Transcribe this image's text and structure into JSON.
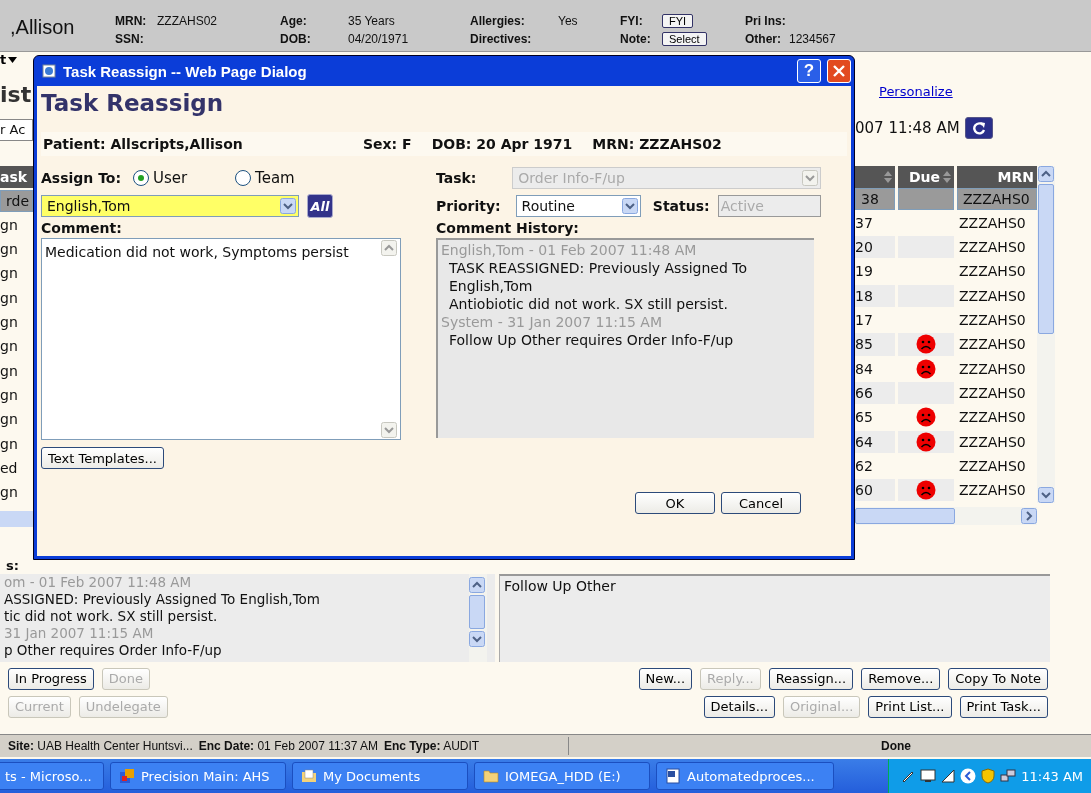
{
  "header": {
    "patient_name": ",Allison",
    "columns": [
      {
        "rows": [
          {
            "label": "MRN:",
            "value": "ZZZAHS02",
            "kind": "text"
          },
          {
            "label": "SSN:"
          }
        ]
      },
      {
        "rows": [
          {
            "label": "Age:",
            "value": "35 Years",
            "kind": "text"
          },
          {
            "label": "DOB:",
            "value": "04/20/1971",
            "kind": "text"
          }
        ]
      },
      {
        "rows": [
          {
            "label": "Allergies:",
            "value": "Yes",
            "kind": "text"
          },
          {
            "label": "Directives:"
          }
        ]
      },
      {
        "rows": [
          {
            "label": "FYI:",
            "value": "FYI",
            "kind": "button"
          },
          {
            "label": "Note:",
            "value": "Select",
            "kind": "button"
          }
        ]
      },
      {
        "rows": [
          {
            "label": "Pri Ins:"
          },
          {
            "label": "Other:",
            "value": "1234567",
            "kind": "text"
          }
        ]
      }
    ]
  },
  "menu": {
    "label": "t"
  },
  "page": {
    "title": "ist",
    "filter": "r Ac",
    "personalize": "Personalize",
    "timestamp": "007 11:48 AM"
  },
  "tasks": {
    "columns": [
      {
        "label": "ask"
      },
      {
        "sortable": true
      },
      {
        "label": "Due",
        "sortable": true
      },
      {
        "label": "MRN"
      }
    ],
    "rows": [
      {
        "column_1": "rde",
        "column_2": "38",
        "overdue": false,
        "mrn": "ZZZAHS0",
        "selected": true
      },
      {
        "column_1": "gn",
        "column_2": "37",
        "overdue": false,
        "mrn": "ZZZAHS0",
        "selected": false
      },
      {
        "column_1": "gn",
        "column_2": "20",
        "overdue": false,
        "mrn": "ZZZAHS0",
        "selected": false
      },
      {
        "column_1": "gn",
        "column_2": "19",
        "overdue": false,
        "mrn": "ZZZAHS0",
        "selected": false
      },
      {
        "column_1": "gn",
        "column_2": "18",
        "overdue": false,
        "mrn": "ZZZAHS0",
        "selected": false
      },
      {
        "column_1": "gn",
        "column_2": "17",
        "overdue": false,
        "mrn": "ZZZAHS0",
        "selected": false
      },
      {
        "column_1": "gn",
        "column_2": "85",
        "overdue": true,
        "mrn": "ZZZAHS0",
        "selected": false
      },
      {
        "column_1": "gn",
        "column_2": "84",
        "overdue": true,
        "mrn": "ZZZAHS0",
        "selected": false
      },
      {
        "column_1": "gn",
        "column_2": "66",
        "overdue": false,
        "mrn": "ZZZAHS0",
        "selected": false
      },
      {
        "column_1": "gn",
        "column_2": "65",
        "overdue": true,
        "mrn": "ZZZAHS0",
        "selected": false
      },
      {
        "column_1": "gn",
        "column_2": "64",
        "overdue": true,
        "mrn": "ZZZAHS0",
        "selected": false
      },
      {
        "column_1": "ed",
        "column_2": "62",
        "overdue": false,
        "mrn": "ZZZAHS0",
        "selected": false
      },
      {
        "column_1": "gn",
        "column_2": "60",
        "overdue": true,
        "mrn": "ZZZAHS0",
        "selected": false
      }
    ]
  },
  "dialog": {
    "title": "Task Reassign -- Web Page Dialog",
    "help": "?",
    "heading": "Task Reassign",
    "patient": [
      {
        "label": "Patient:",
        "value": "Allscripts,Allison"
      },
      {
        "label": "Sex:",
        "value": "F"
      },
      {
        "label": "DOB:",
        "value": "20 Apr 1971"
      },
      {
        "label": "MRN:",
        "value": "ZZZAHS02"
      }
    ],
    "assign_to": {
      "label": "Assign To:",
      "options": [
        {
          "label": "User",
          "selected": true
        },
        {
          "label": "Team",
          "selected": false
        }
      ]
    },
    "assignee": {
      "value": "English,Tom",
      "all_button": "All"
    },
    "task": {
      "label": "Task:",
      "value": "Order Info-F/up",
      "disabled": true
    },
    "priority": {
      "label": "Priority:",
      "value": "Routine"
    },
    "status": {
      "label": "Status:",
      "value": "Active",
      "disabled": true
    },
    "comment": {
      "label": "Comment:",
      "value": "Medication did not work, Symptoms persist"
    },
    "history": {
      "label": "Comment History:",
      "entries": [
        {
          "kind": "header",
          "text": "English,Tom - 01 Feb 2007 11:48 AM"
        },
        {
          "kind": "body",
          "text": "TASK REASSIGNED: Previously Assigned To English,Tom"
        },
        {
          "kind": "body",
          "text": "Antiobiotic did not work. SX still persist."
        },
        {
          "kind": "header",
          "text": "System - 31 Jan 2007 11:15 AM"
        },
        {
          "kind": "body",
          "text": "Follow Up Other requires Order Info-F/up"
        }
      ]
    },
    "templates_button": {
      "label": "Text Templates..."
    },
    "buttons": [
      {
        "label": "OK"
      },
      {
        "label": "Cancel"
      }
    ]
  },
  "details": {
    "label": "s:",
    "history": [
      {
        "kind": "header",
        "text": "om - 01 Feb 2007 11:48 AM"
      },
      {
        "kind": "body",
        "text": "ASSIGNED: Previously Assigned To English,Tom"
      },
      {
        "kind": "body",
        "text": "tic did not work. SX still persist."
      },
      {
        "kind": "header",
        "text": "31 Jan 2007 11:15 AM"
      },
      {
        "kind": "body",
        "text": "p Other requires Order Info-F/up"
      }
    ],
    "description": "Follow Up Other"
  },
  "actions": {
    "row_1_left": [
      {
        "label": "In Progress",
        "disabled": false
      },
      {
        "label": "Done",
        "disabled": true
      }
    ],
    "row_1_right": [
      {
        "label": "New...",
        "disabled": false
      },
      {
        "label": "Reply...",
        "disabled": true
      },
      {
        "label": "Reassign...",
        "disabled": false
      },
      {
        "label": "Remove...",
        "disabled": false
      },
      {
        "label": "Copy To Note",
        "disabled": false
      }
    ],
    "row_2_left": [
      {
        "label": "Current",
        "disabled": true
      },
      {
        "label": "Undelegate",
        "disabled": true
      }
    ],
    "row_2_right": [
      {
        "label": "Details...",
        "disabled": false
      },
      {
        "label": "Original...",
        "disabled": true
      },
      {
        "label": "Print List...",
        "disabled": false
      },
      {
        "label": "Print Task...",
        "disabled": false
      }
    ]
  },
  "status_bar": {
    "segments": [
      {
        "label": "Site:",
        "value": "UAB Health Center Huntsvi..."
      },
      {
        "label": "Enc Date:",
        "value": "01 Feb 2007 11:37 AM"
      },
      {
        "label": "Enc Type:",
        "value": "AUDIT"
      }
    ],
    "status": "Done"
  },
  "taskbar": {
    "items": [
      {
        "label": "ts - Microso...",
        "kind": "none"
      },
      {
        "label": "Precision Main: AHS",
        "kind": "app"
      },
      {
        "label": "My Documents",
        "kind": "documents"
      },
      {
        "label": "IOMEGA_HDD (E:)",
        "kind": "folder"
      },
      {
        "label": "Automatedproces...",
        "kind": "word"
      }
    ],
    "clock": "11:43 AM"
  }
}
